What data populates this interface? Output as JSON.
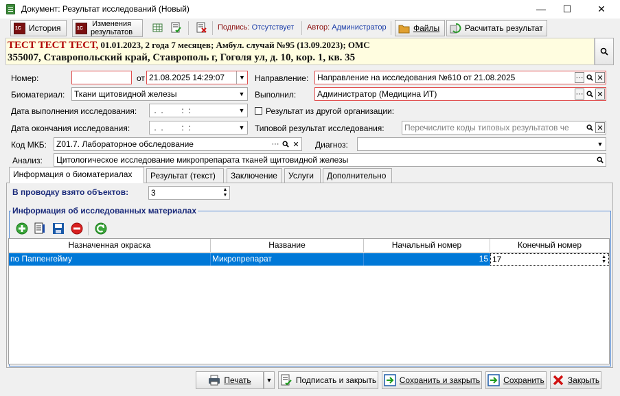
{
  "window": {
    "title": "Документ: Результат исследований (Новый)",
    "minimize": "—",
    "maximize": "☐",
    "close": "✕"
  },
  "toolbar": {
    "history": "История",
    "changes_line1": "Изменения",
    "changes_line2": "результатов",
    "signature_label": "Подпись:",
    "signature_value": "Отсутствует",
    "author_label": "Автор:",
    "author_value": "Администратор",
    "files": "Файлы",
    "calculate": "Расчитать результат"
  },
  "patient": {
    "name": "ТЕСТ ТЕСТ ТЕСТ,",
    "info": " 01.01.2023, 2 года 7 месяцев; Амбул. случай №95 (13.09.2023); ОМС",
    "address": "355007, Ставропольский край, Ставрополь г, Гоголя ул, д. 10, кор. 1, кв. 35"
  },
  "form": {
    "number_label": "Номер:",
    "number_value": "",
    "from_label": "от",
    "date_value": "21.08.2025 14:29:07",
    "direction_label": "Направление:",
    "direction_value": "Направление на исследования №610 от 21.08.2025",
    "biomaterial_label": "Биоматериал:",
    "biomaterial_value": "Ткани щитовидной железы",
    "performer_label": "Выполнил:",
    "performer_value": "Администратор (Медицина ИТ)",
    "exec_date_label": "Дата выполнения исследования:",
    "exec_date_value": " .  .        :  :",
    "other_org_label": "Результат из другой организации:",
    "end_date_label": "Дата окончания исследования:",
    "end_date_value": " .  .        :  :",
    "typical_label": "Типовой результат исследования:",
    "typical_placeholder": "Перечислите коды типовых результатов че",
    "mkb_label": "Код МКБ:",
    "mkb_value": "Z01.7. Лабораторное обследование",
    "diagnosis_label": "Диагноз:",
    "diagnosis_value": "",
    "analysis_label": "Анализ:",
    "analysis_value": "Цитологическое исследование микропрепарата тканей щитовидной железы"
  },
  "tabs": [
    "Информация о биоматериалах",
    "Результат (текст)",
    "Заключение",
    "Услуги",
    "Дополнительно"
  ],
  "panel": {
    "objects_label": "В проводку взято объектов:",
    "objects_value": "3",
    "group_title": "Информация об исследованных материалах"
  },
  "grid": {
    "columns": [
      "Назначенная окраска",
      "Название",
      "Начальный номер",
      "Конечный номер"
    ],
    "rows": [
      [
        "по Паппенгейму",
        "Микропрепарат",
        "15",
        "17"
      ]
    ]
  },
  "bottom": {
    "print": "Печать",
    "sign_close": "Подписать и закрыть",
    "save_close": "Сохранить и закрыть",
    "save": "Сохранить",
    "close": "Закрыть"
  },
  "colors": {
    "accent": "#0078d7",
    "error_border": "#e05050",
    "patient_bg": "#fffde0",
    "name_red": "#b00000"
  }
}
